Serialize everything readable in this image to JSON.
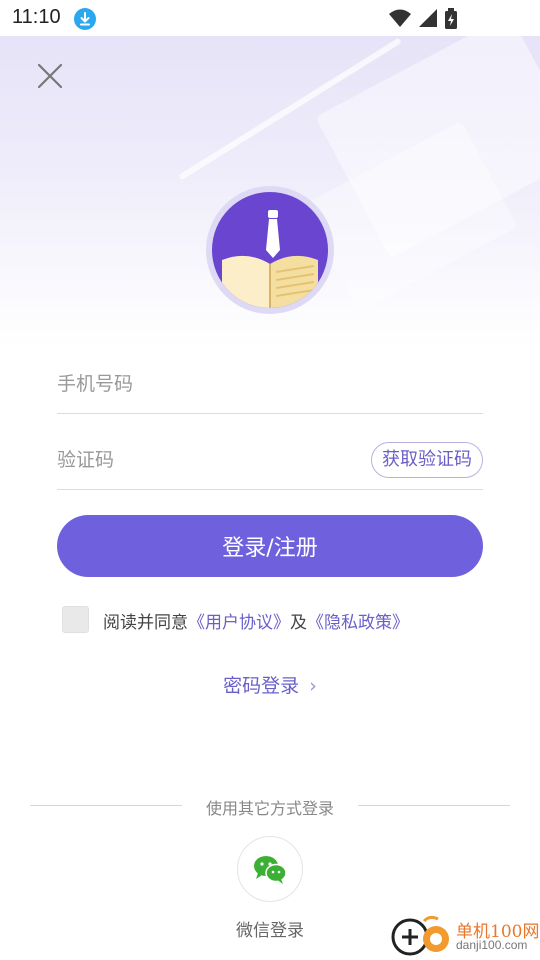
{
  "status_bar": {
    "time": "11:10"
  },
  "colors": {
    "accent": "#6f61de",
    "link": "#6a5fc9",
    "avatar_bg": "#6a45cf",
    "wechat_green": "#3cb034"
  },
  "form": {
    "phone_placeholder": "手机号码",
    "code_placeholder": "验证码",
    "get_code_label": "获取验证码",
    "submit_label": "登录/注册"
  },
  "agreement": {
    "prefix": "阅读并同意",
    "user_agreement": "《用户协议》",
    "joiner": "及",
    "privacy_policy": "《隐私政策》"
  },
  "password_login": {
    "label": "密码登录",
    "chevron": "›"
  },
  "other_login": {
    "divider_label": "使用其它方式登录",
    "wechat_label": "微信登录"
  },
  "watermark": {
    "brand": "单机100网",
    "url": "danji100.com"
  }
}
